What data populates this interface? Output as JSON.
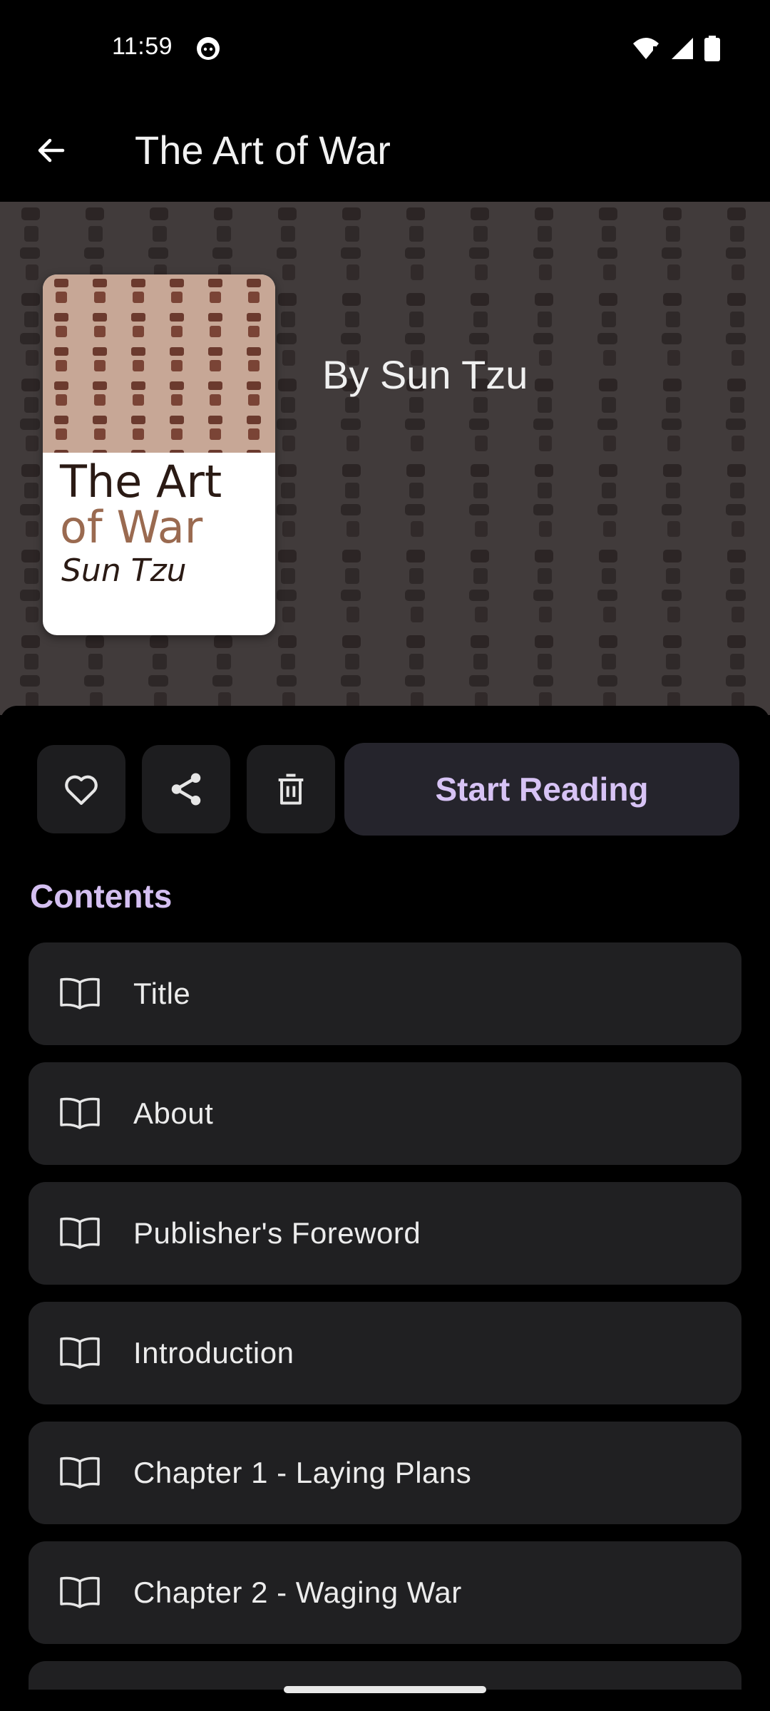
{
  "status_bar": {
    "time": "11:59"
  },
  "app_bar": {
    "title": "The Art of War"
  },
  "hero": {
    "cover": {
      "title_line1": "The Art",
      "title_line2": "of War",
      "author": "Sun Tzu"
    },
    "author_text": "By Sun Tzu"
  },
  "actions": {
    "start_reading_label": "Start Reading"
  },
  "contents": {
    "heading": "Contents",
    "items": [
      {
        "label": "Title"
      },
      {
        "label": "About"
      },
      {
        "label": "Publisher's Foreword"
      },
      {
        "label": "Introduction"
      },
      {
        "label": "Chapter 1 - Laying Plans"
      },
      {
        "label": "Chapter 2 - Waging War"
      }
    ]
  },
  "colors": {
    "accent": "#d7c3f5",
    "surface": "#202022",
    "background": "#000000"
  },
  "icons": [
    "arrow-back-icon",
    "heart-icon",
    "share-icon",
    "trash-icon",
    "book-open-icon",
    "wifi-icon",
    "signal-icon",
    "battery-icon"
  ]
}
